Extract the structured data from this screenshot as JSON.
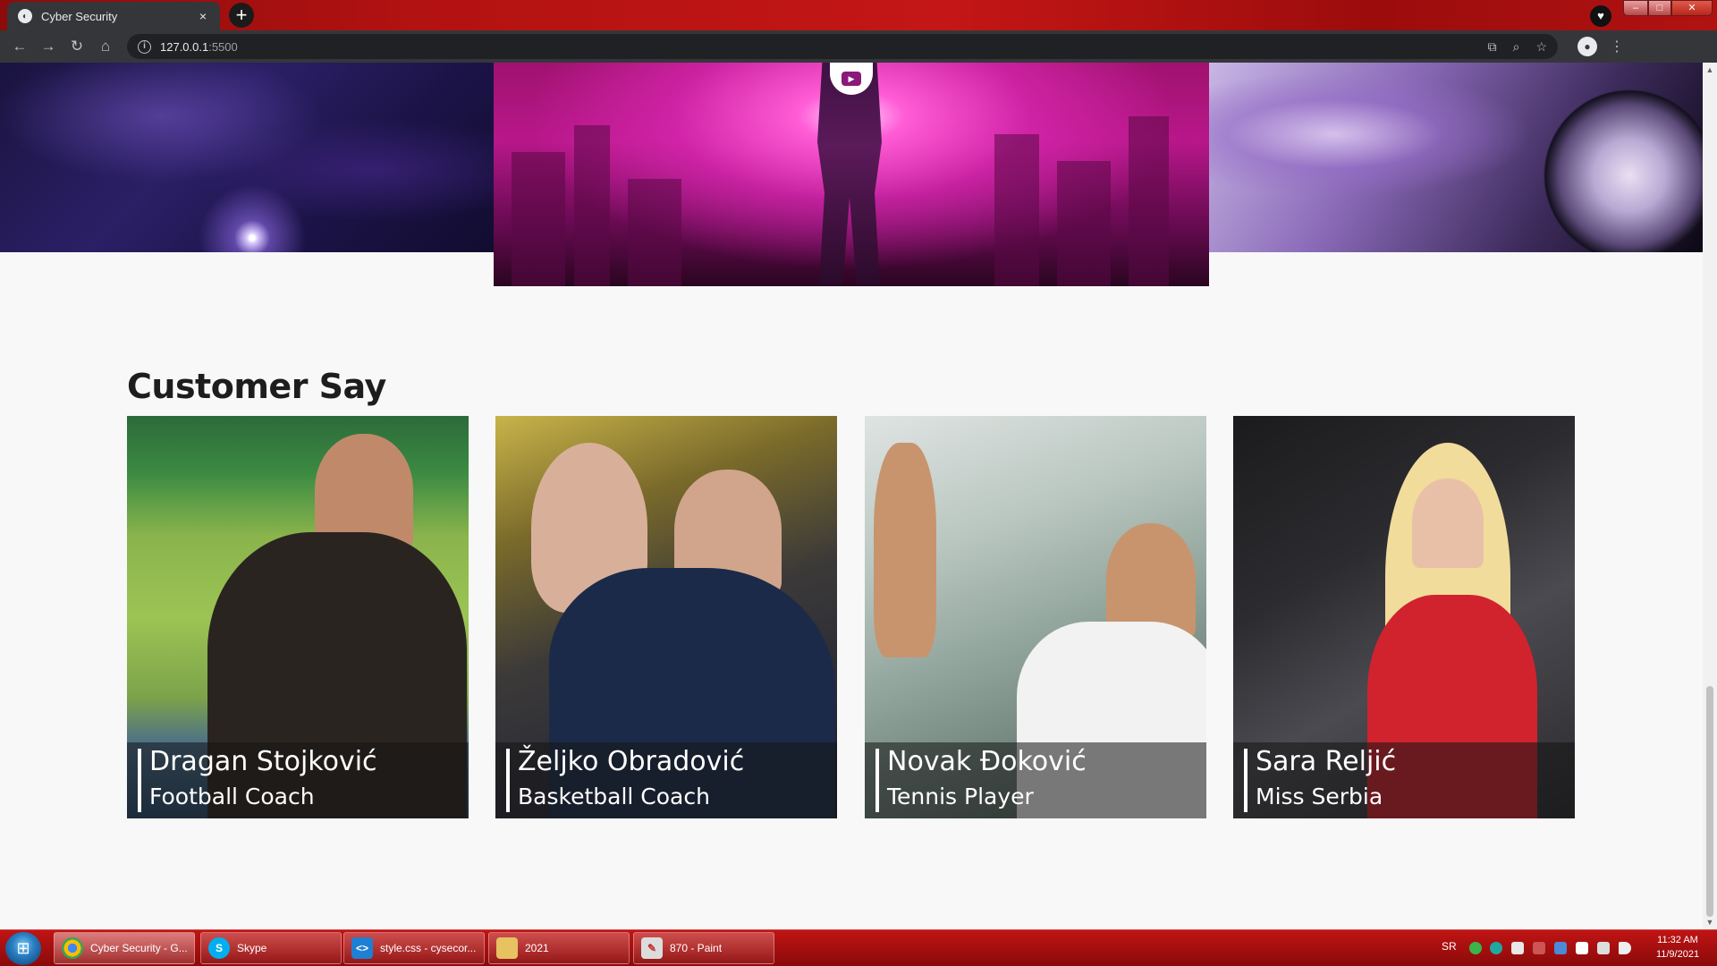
{
  "browser": {
    "tab_title": "Cyber Security",
    "tab_close": "×",
    "new_tab": "+",
    "url_host": "127.0.0.1",
    "url_port": ":5500"
  },
  "icons": {
    "back": "←",
    "forward": "→",
    "reload": "↻",
    "home": "⌂",
    "translate": "⧉",
    "zoom": "⌕",
    "star": "☆",
    "account": "●",
    "menu": "⋮",
    "info": "i",
    "favicon": "◐",
    "play": "▶",
    "extension": "♥"
  },
  "page": {
    "section_title": "Customer Say",
    "customers": [
      {
        "name": "Dragan Stojković",
        "role": "Football Coach"
      },
      {
        "name": "Željko Obradović",
        "role": "Basketball Coach"
      },
      {
        "name": "Novak Đoković",
        "role": "Tennis Player"
      },
      {
        "name": "Sara Reljić",
        "role": "Miss Serbia"
      }
    ]
  },
  "taskbar": {
    "items": [
      {
        "label": "Cyber Security - G...",
        "icon": "chrome-icon"
      },
      {
        "label": "Skype",
        "icon": "skype-icon"
      },
      {
        "label": "style.css - cysecor...",
        "icon": "vscode-icon"
      },
      {
        "label": "2021",
        "icon": "folder-icon"
      },
      {
        "label": "870 - Paint",
        "icon": "paint-icon"
      }
    ],
    "language": "SR",
    "time": "11:32 AM",
    "date": "11/9/2021"
  },
  "colors": {
    "taskbar_red": "#a60f0f",
    "titlebar_red": "#b31212",
    "toolbar_dark": "#35363a"
  }
}
